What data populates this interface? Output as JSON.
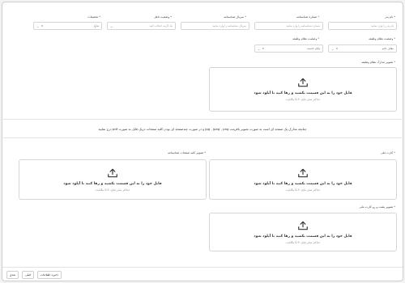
{
  "form": {
    "row1": {
      "f1": {
        "label": "نام پدر",
        "placeholder": "نام پدر را وارد نمایید"
      },
      "f2": {
        "label": "شماره شناسنامه",
        "placeholder": "شماره شناسنامه را وارد نمایید"
      },
      "f3": {
        "label": "سریال شناسنامه",
        "placeholder": "سریال شناسنامه را وارد نمایید"
      },
      "f4": {
        "label": "وضعیت تاهل",
        "placeholder": "یک گزینه انتخاب کنید"
      },
      "f5": {
        "label": "تحصیلات",
        "value": "ندارد"
      }
    },
    "row2": {
      "f1": {
        "label": "وضعیت نظام وظیفه",
        "value": "معاف دائم"
      },
      "f2": {
        "label": "وضعیت نظام وظیفه",
        "value": "پایان خدمت"
      }
    },
    "military_upload_label": "تصویر مدارک نظام وظیفه",
    "upload": {
      "title": "فایل خود را به این قسمت بکشید و رها کنید تا آپلود شود",
      "subtitle": "حداکثر سایز فایل: 0.5 مگابایت"
    },
    "note": "چنانچه مدارک یک صفحه ای است به صورت تصویر بافرمت jpg , jpeg , png و در صورت چندصفحه ای بودن کلیه صفحات درپک فایل به صورت pdf درج نمایید",
    "uploads2": {
      "right_label": "کارت ملی",
      "left_label": "تصویر کلیه صفحات شناسنامه",
      "bottom_label": "تصویر پشت و رو کارت ملی"
    }
  },
  "footer": {
    "next": "بعدی",
    "prev": "قبلی",
    "save": "ذخیره اطلاعات"
  }
}
